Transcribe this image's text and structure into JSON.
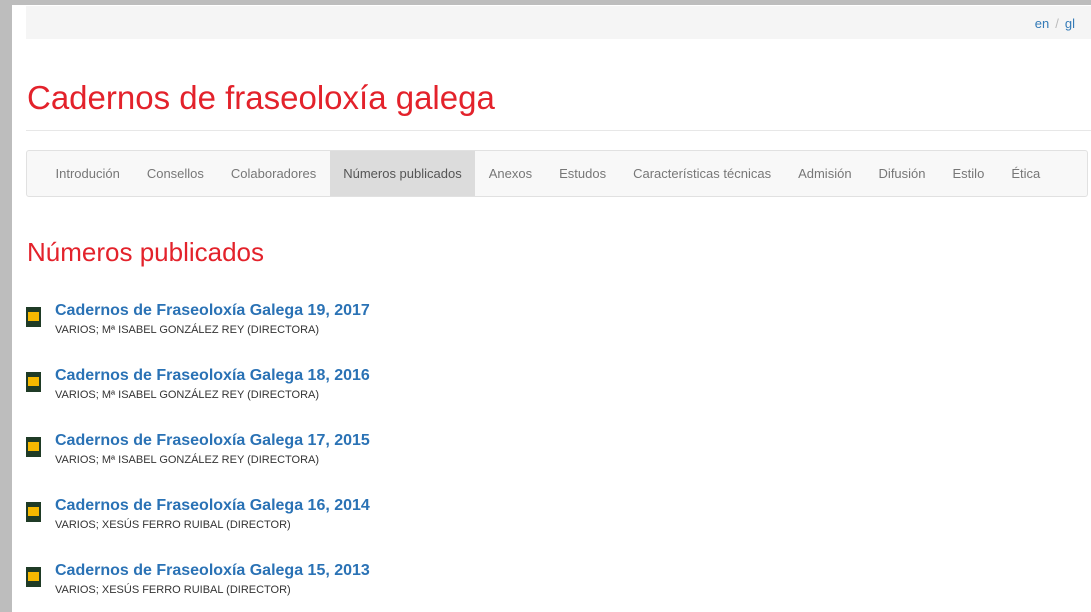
{
  "languages": [
    {
      "label": "en"
    },
    {
      "label": "gl"
    }
  ],
  "language_separator": "/",
  "site_title": "Cadernos de fraseoloxía galega",
  "nav": {
    "items": [
      {
        "label": "Introdución",
        "active": false
      },
      {
        "label": "Consellos",
        "active": false
      },
      {
        "label": "Colaboradores",
        "active": false
      },
      {
        "label": "Números publicados",
        "active": true
      },
      {
        "label": "Anexos",
        "active": false
      },
      {
        "label": "Estudos",
        "active": false
      },
      {
        "label": "Características técnicas",
        "active": false
      },
      {
        "label": "Admisión",
        "active": false
      },
      {
        "label": "Difusión",
        "active": false
      },
      {
        "label": "Estilo",
        "active": false
      },
      {
        "label": "Ética",
        "active": false
      }
    ]
  },
  "section_title": "Números publicados",
  "issues": [
    {
      "title": "Cadernos de Fraseoloxía Galega 19, 2017",
      "author": "VARIOS; Mª ISABEL GONZÁLEZ REY (DIRECTORA)"
    },
    {
      "title": "Cadernos de Fraseoloxía Galega 18, 2016",
      "author": "VARIOS; Mª ISABEL GONZÁLEZ REY (DIRECTORA)"
    },
    {
      "title": "Cadernos de Fraseoloxía Galega 17, 2015",
      "author": "VARIOS; Mª ISABEL GONZÁLEZ REY (DIRECTORA)"
    },
    {
      "title": "Cadernos de Fraseoloxía Galega 16, 2014",
      "author": "VARIOS; XESÚS FERRO RUIBAL (DIRECTOR)"
    },
    {
      "title": "Cadernos de Fraseoloxía Galega 15, 2013",
      "author": "VARIOS; XESÚS FERRO RUIBAL (DIRECTOR)"
    }
  ],
  "colors": {
    "brand_red": "#e3222b",
    "link_blue": "#2a72b5",
    "cover_green": "#1f3b26",
    "cover_yellow": "#f5b800"
  }
}
